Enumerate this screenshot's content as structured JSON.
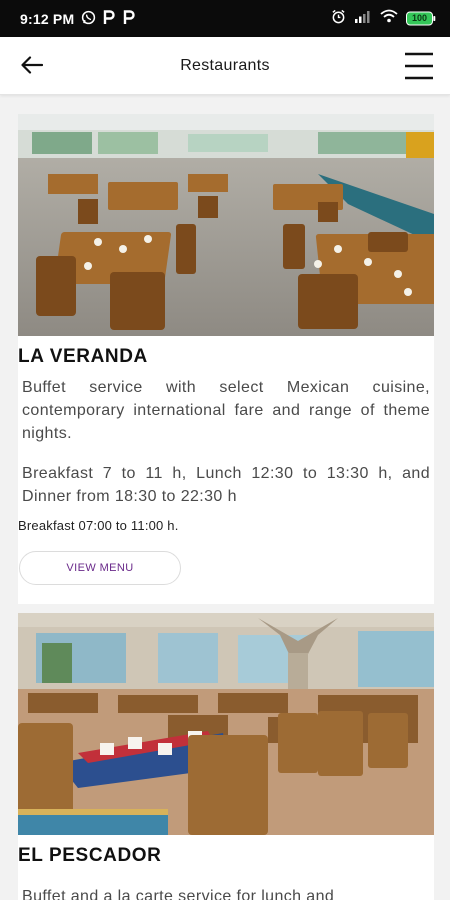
{
  "status": {
    "time": "9:12 PM",
    "battery": "100"
  },
  "header": {
    "title": "Restaurants"
  },
  "restaurants": [
    {
      "name": "LA VERANDA",
      "description": "Buffet service with select Mexican cuisine, contemporary international fare and range of theme nights.",
      "hours": "Breakfast 7 to 11 h, Lunch 12:30 to 13:30 h, and Dinner from 18:30 to 22:30 h",
      "hours_short": "Breakfast 07:00 to 11:00 h.",
      "button_label": "VIEW MENU"
    },
    {
      "name": "EL PESCADOR",
      "description": "Buffet and a la carte service for lunch and"
    }
  ],
  "colors": {
    "accent": "#6a2a8a",
    "status_bar": "#0b0b0b",
    "battery": "#34c759"
  },
  "icons": {
    "back": "arrow-left-icon",
    "menu": "hamburger-menu-icon"
  }
}
